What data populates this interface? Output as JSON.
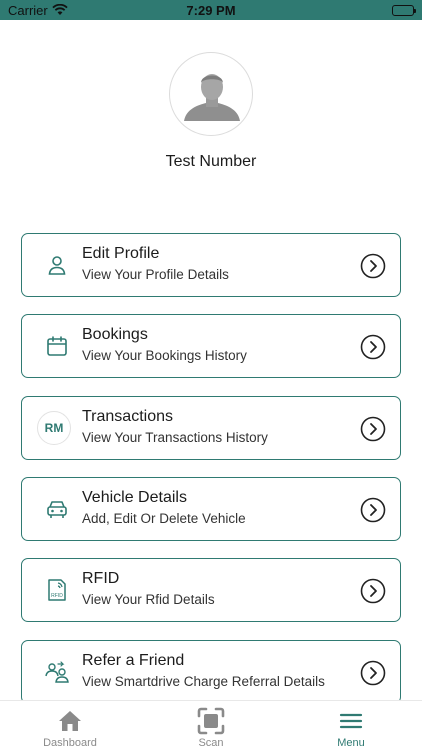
{
  "status_bar": {
    "carrier": "Carrier",
    "time": "7:29 PM"
  },
  "profile": {
    "name": "Test Number",
    "avatar_icon": "user-avatar-icon"
  },
  "menu": [
    {
      "title": "Edit Profile",
      "subtitle": "View Your Profile Details",
      "icon": "person-icon"
    },
    {
      "title": "Bookings",
      "subtitle": "View Your Bookings History",
      "icon": "calendar-icon"
    },
    {
      "title": "Transactions",
      "subtitle": "View Your Transactions History",
      "icon": "rm-currency-icon",
      "badge": "RM"
    },
    {
      "title": "Vehicle Details",
      "subtitle": "Add, Edit Or Delete Vehicle",
      "icon": "car-icon"
    },
    {
      "title": "RFID",
      "subtitle": "View Your Rfid Details",
      "icon": "rfid-card-icon",
      "badge": "RFID"
    },
    {
      "title": "Refer a Friend",
      "subtitle": "View Smartdrive Charge Referral Details",
      "icon": "refer-friend-icon"
    }
  ],
  "tabs": [
    {
      "label": "Dashboard",
      "icon": "home-icon",
      "active": false
    },
    {
      "label": "Scan",
      "icon": "scan-icon",
      "active": false
    },
    {
      "label": "Menu",
      "icon": "hamburger-menu-icon",
      "active": true
    }
  ],
  "colors": {
    "accent": "#2f7a72",
    "tab_inactive": "#8a8a8a",
    "text": "#1c1c1c"
  }
}
